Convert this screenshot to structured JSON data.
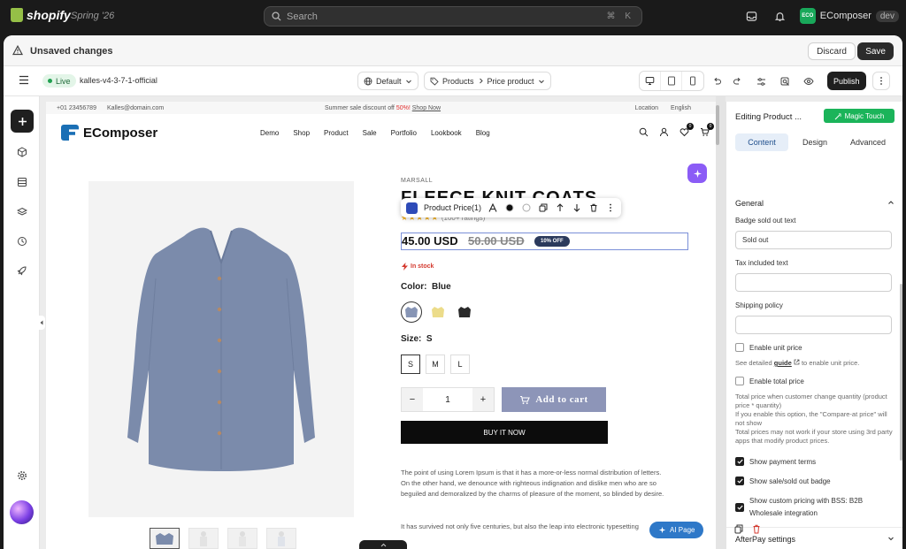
{
  "shopify": {
    "brand": "shopify",
    "edition": "Spring '26",
    "search_placeholder": "Search",
    "search_shortcut": "⌘ K",
    "store_avatar": "ECO",
    "store_name": "EComposer",
    "store_badge": "dev"
  },
  "unsaved": {
    "text": "Unsaved changes",
    "discard": "Discard",
    "save": "Save"
  },
  "toolbar": {
    "live": "Live",
    "theme": "kalles-v4-3-7-1-official",
    "layout": "Default",
    "crumb_1": "Products",
    "crumb_2": "Price product",
    "publish": "Publish"
  },
  "store": {
    "ann_phone": "+01 23456789",
    "ann_email": "Kalles@domain.com",
    "ann_pre": "Summer sale discount off ",
    "ann_pct": "50%!",
    "ann_link": "Shop Now",
    "ann_location": "Location",
    "ann_lang": "English",
    "logo": "EComposer",
    "nav": [
      "Demo",
      "Shop",
      "Product",
      "Sale",
      "Portfolio",
      "Lookbook",
      "Blog"
    ],
    "wishlist_count": "0",
    "cart_count": "0",
    "vendor": "MARSALL",
    "title": "FLEECE KNIT COATS",
    "ratings": "(100+ ratings)",
    "price_now": "45.00 USD",
    "price_was": "50.00 USD",
    "discount": "10% OFF",
    "stock": "In stock",
    "color_label": "Color:",
    "color_value": "Blue",
    "size_label": "Size:",
    "size_value": "S",
    "sizes": [
      "S",
      "M",
      "L"
    ],
    "qty": "1",
    "add_to_cart": "Add to cart",
    "buy_now": "BUY IT NOW",
    "desc": "The point of using Lorem Ipsum is that it has a more-or-less normal distribution of letters. On the other hand, we denounce with righteous indignation and dislike men who are so beguiled and demoralized by the charms of pleasure of the moment, so blinded by desire.",
    "desc2": "It has survived not only five centuries, but also the leap into electronic typesetting",
    "ai_page": "AI Page"
  },
  "float_bar": {
    "label": "Product Price(1)"
  },
  "panel": {
    "title": "Editing Product ...",
    "magic": "Magic Touch",
    "tabs": [
      "Content",
      "Design",
      "Advanced"
    ],
    "section": "General",
    "badge_label": "Badge sold out text",
    "badge_value": "Sold out",
    "tax_label": "Tax included text",
    "tax_value": "",
    "ship_label": "Shipping policy",
    "ship_value": "",
    "unit_price": "Enable unit price",
    "guide_pre": "See detailed ",
    "guide_link": "guide",
    "guide_post": " to enable unit price.",
    "total_price": "Enable total price",
    "total_hint_1": "Total price when customer change quantity (product price * quantity)",
    "total_hint_2": "If you enable this option, the \"Compare-at price\" will not show",
    "total_hint_3": "Total prices may not work if your store using 3rd party apps that modify product prices.",
    "pay_terms": "Show payment terms",
    "sale_badge": "Show sale/sold out badge",
    "custom_pricing": "Show custom pricing with BSS: B2B Wholesale integration",
    "afterpay": "AfterPay settings"
  }
}
